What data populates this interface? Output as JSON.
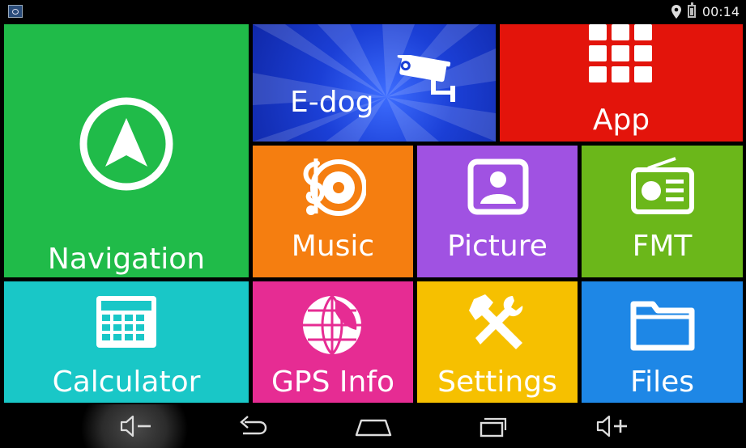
{
  "status_bar": {
    "time": "00:14",
    "icons": [
      "notification-app-icon",
      "location-pin-icon",
      "battery-icon"
    ]
  },
  "tiles": {
    "navigation": {
      "label": "Navigation",
      "icon": "navigation-arrow-icon",
      "color": "#20bb49"
    },
    "edog": {
      "label": "E-dog",
      "icon": "camera-icon",
      "color": "#1b3fd6"
    },
    "app": {
      "label": "App",
      "icon": "app-grid-icon",
      "color": "#e3140b"
    },
    "music": {
      "label": "Music",
      "icon": "music-disc-icon",
      "color": "#f57e10"
    },
    "picture": {
      "label": "Picture",
      "icon": "picture-icon",
      "color": "#a052e2"
    },
    "fmt": {
      "label": "FMT",
      "icon": "radio-icon",
      "color": "#6bb71a"
    },
    "calculator": {
      "label": "Calculator",
      "icon": "calculator-icon",
      "color": "#19c7c7"
    },
    "gps": {
      "label": "GPS Info",
      "icon": "globe-icon",
      "color": "#e62c93"
    },
    "settings": {
      "label": "Settings",
      "icon": "tools-icon",
      "color": "#f6c000"
    },
    "files": {
      "label": "Files",
      "icon": "folder-icon",
      "color": "#1e87e6"
    }
  },
  "nav_bar": {
    "buttons": [
      "volume-down-icon",
      "back-icon",
      "home-icon",
      "recent-apps-icon",
      "volume-up-icon"
    ]
  }
}
